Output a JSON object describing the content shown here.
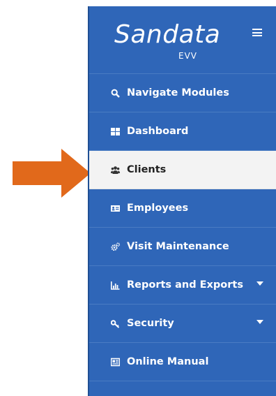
{
  "brand": {
    "name": "Sandata",
    "sub": "EVV"
  },
  "colors": {
    "sidebar_bg": "#2f66b8",
    "active_bg": "#f3f3f3",
    "arrow": "#e1691b"
  },
  "menu": {
    "items": [
      {
        "label": "Navigate Modules",
        "icon": "search-icon"
      },
      {
        "label": "Dashboard",
        "icon": "grid-icon"
      },
      {
        "label": "Clients",
        "icon": "users-icon",
        "active": true
      },
      {
        "label": "Employees",
        "icon": "id-card-icon"
      },
      {
        "label": "Visit Maintenance",
        "icon": "gears-icon"
      },
      {
        "label": "Reports and Exports",
        "icon": "bar-chart-icon",
        "has_submenu": true
      },
      {
        "label": "Security",
        "icon": "key-icon",
        "has_submenu": true
      },
      {
        "label": "Online Manual",
        "icon": "manual-icon"
      }
    ]
  }
}
